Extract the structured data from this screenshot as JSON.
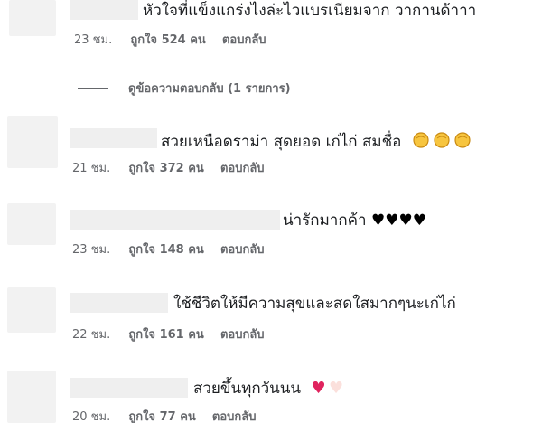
{
  "comments": [
    {
      "text": "หัวใจที่แข็งแกร่งไงล่ะไวแบรเนียมจาก วากานด้าาา",
      "time": "23 ชม.",
      "likes": "ถูกใจ 524 คน",
      "reply": "ตอบกลับ"
    },
    {
      "text": "สวยเหนือดราม่า สุดยอด เก่ไก่ สมชื่อ",
      "emoji": "clapping-hands x3",
      "time": "21 ชม.",
      "likes": "ถูกใจ 372 คน",
      "reply": "ตอบกลับ"
    },
    {
      "text": "น่ารักมากค้า",
      "emoji": "black-heart x4",
      "time": "23 ชม.",
      "likes": "ถูกใจ 148 คน",
      "reply": "ตอบกลับ"
    },
    {
      "text": "ใช้ชีวิตให้มีความสุขและสดใสมากๆนะเก่ไก่",
      "time": "22 ชม.",
      "likes": "ถูกใจ 161 คน",
      "reply": "ตอบกลับ"
    },
    {
      "text": "สวยขึ้นทุกวันนน",
      "emoji": "red-heart, white-heart",
      "time": "20 ชม.",
      "likes": "ถูกใจ 77 คน",
      "reply": "ตอบกลับ"
    }
  ],
  "view_replies": "ดูข้อความตอบกลับ (1 รายการ)",
  "colors": {
    "text": "#1c1e21",
    "meta": "#65676b",
    "placeholder": "#efefef",
    "heart_red": "#e0245e"
  }
}
